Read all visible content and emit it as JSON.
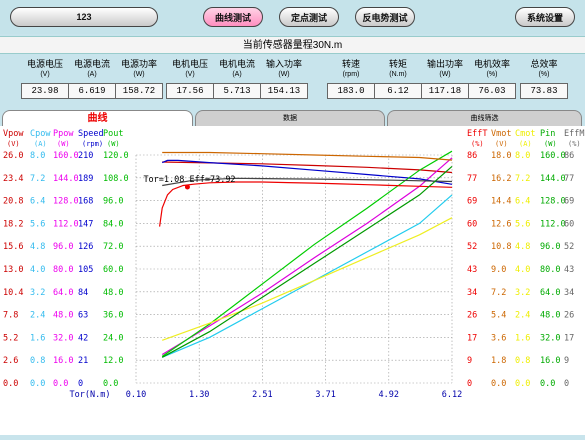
{
  "toolbar": {
    "file_box": "123",
    "curve_test": "曲线测试",
    "point_test": "定点测试",
    "back_emf_test": "反电势测试",
    "settings": "系统设置"
  },
  "subtitle": "当前传感器量程30N.m",
  "metrics": [
    {
      "label": "电源电压",
      "unit": "(V)",
      "value": "23.98"
    },
    {
      "label": "电源电流",
      "unit": "(A)",
      "value": "6.619"
    },
    {
      "label": "电源功率",
      "unit": "(W)",
      "value": "158.72"
    },
    {
      "label": "电机电压",
      "unit": "(V)",
      "value": "17.56"
    },
    {
      "label": "电机电流",
      "unit": "(A)",
      "value": "5.713"
    },
    {
      "label": "输入功率",
      "unit": "(W)",
      "value": "154.13"
    },
    {
      "label": "转速",
      "unit": "(rpm)",
      "value": "183.0"
    },
    {
      "label": "转矩",
      "unit": "(N.m)",
      "value": "6.12"
    },
    {
      "label": "输出功率",
      "unit": "(W)",
      "value": "117.18"
    },
    {
      "label": "电机效率",
      "unit": "(%)",
      "value": "76.03"
    },
    {
      "label": "总效率",
      "unit": "(%)",
      "value": "73.83"
    }
  ],
  "tabs": [
    "曲线",
    "数据",
    "曲线筛选"
  ],
  "chart_data": {
    "type": "line",
    "xlabel": "Tor(N.m)",
    "x_ticks": [
      "0.10",
      "1.30",
      "2.51",
      "3.71",
      "4.92",
      "6.12"
    ],
    "xlim": [
      0.1,
      6.12
    ],
    "annotation": "Tor=1.08 Eff=73.92",
    "left_axes": [
      {
        "name": "Vpow",
        "unit": "(V)",
        "color": "#cc0000",
        "ticks": [
          "26.0",
          "23.4",
          "20.8",
          "18.2",
          "15.6",
          "13.0",
          "10.4",
          "7.8",
          "5.2",
          "2.6",
          "0.0"
        ]
      },
      {
        "name": "Cpow",
        "unit": "(A)",
        "color": "#33bbee",
        "ticks": [
          "8.0",
          "7.2",
          "6.4",
          "5.6",
          "4.8",
          "4.0",
          "3.2",
          "2.4",
          "1.6",
          "0.8",
          "0.0"
        ]
      },
      {
        "name": "Ppow",
        "unit": "(W)",
        "color": "#ee00ee",
        "ticks": [
          "160.0",
          "144.0",
          "128.0",
          "112.0",
          "96.0",
          "80.0",
          "64.0",
          "48.0",
          "32.0",
          "16.0",
          "0.0"
        ]
      },
      {
        "name": "Speed",
        "unit": "(rpm)",
        "color": "#0000cc",
        "ticks": [
          "210",
          "189",
          "168",
          "147",
          "126",
          "105",
          "84",
          "63",
          "42",
          "21",
          "0"
        ]
      },
      {
        "name": "Pout",
        "unit": "(W)",
        "color": "#00bb00",
        "ticks": [
          "120.0",
          "108.0",
          "96.0",
          "84.0",
          "72.0",
          "60.0",
          "48.0",
          "36.0",
          "24.0",
          "12.0",
          "0.0"
        ]
      }
    ],
    "right_axes": [
      {
        "name": "EffT",
        "unit": "(%)",
        "color": "#ee0000",
        "ticks": [
          "86",
          "77",
          "69",
          "60",
          "52",
          "43",
          "34",
          "26",
          "17",
          "9",
          "0"
        ]
      },
      {
        "name": "Vmot",
        "unit": "(V)",
        "color": "#cc6600",
        "ticks": [
          "18.0",
          "16.2",
          "14.4",
          "12.6",
          "10.8",
          "9.0",
          "7.2",
          "5.4",
          "3.6",
          "1.8",
          "0.0"
        ]
      },
      {
        "name": "Cmot",
        "unit": "(A)",
        "color": "#eeee00",
        "ticks": [
          "8.0",
          "7.2",
          "6.4",
          "5.6",
          "4.8",
          "4.0",
          "3.2",
          "2.4",
          "1.6",
          "0.8",
          "0.0"
        ]
      },
      {
        "name": "Pin",
        "unit": "(W)",
        "color": "#00aa00",
        "ticks": [
          "160.0",
          "144.0",
          "128.0",
          "112.0",
          "96.0",
          "80.0",
          "64.0",
          "48.0",
          "32.0",
          "16.0",
          "0.0"
        ]
      },
      {
        "name": "EffM",
        "unit": "(%)",
        "color": "#666666",
        "ticks": [
          "86",
          "77",
          "69",
          "60",
          "52",
          "43",
          "34",
          "26",
          "17",
          "9",
          "0"
        ]
      }
    ],
    "series": [
      {
        "name": "Vpow",
        "color": "#cc0000",
        "x": [
          0.6,
          1.5,
          2.5,
          3.5,
          4.5,
          5.5,
          6.12
        ],
        "y": [
          25.2,
          25.1,
          25.0,
          24.8,
          24.6,
          24.3,
          24.0
        ]
      },
      {
        "name": "Cpow",
        "color": "#22ccee",
        "x": [
          0.6,
          1.5,
          2.5,
          3.5,
          4.5,
          5.5,
          6.12
        ],
        "y": [
          0.9,
          1.6,
          2.6,
          3.6,
          4.6,
          5.6,
          6.6
        ]
      },
      {
        "name": "Ppow",
        "color": "#dd00dd",
        "x": [
          0.6,
          1.5,
          2.5,
          3.5,
          4.5,
          5.5,
          6.12
        ],
        "y": [
          20,
          40,
          63,
          88,
          112,
          138,
          158
        ]
      },
      {
        "name": "Speed",
        "color": "#0000cc",
        "x": [
          0.6,
          0.7,
          0.9,
          1.2,
          1.5,
          2.5,
          3.5,
          4.5,
          5.5,
          6.12
        ],
        "y": [
          203,
          205,
          205,
          204,
          203,
          200,
          196,
          192,
          188,
          183
        ]
      },
      {
        "name": "Pout",
        "color": "#00cc00",
        "x": [
          0.6,
          1.5,
          2.5,
          3.5,
          4.5,
          5.5,
          6.12
        ],
        "y": [
          14,
          31,
          52,
          73,
          92,
          112,
          122
        ]
      },
      {
        "name": "EffT",
        "color": "#ee0000",
        "x": [
          0.55,
          0.6,
          0.7,
          0.8,
          1.0,
          1.2,
          1.5,
          2.0,
          2.5,
          3.0,
          3.5,
          4.0,
          4.5,
          5.0,
          5.5,
          6.12
        ],
        "y": [
          59,
          66,
          71,
          73,
          74.5,
          75,
          75.5,
          75.8,
          75.8,
          75.6,
          75.4,
          75.1,
          74.8,
          74.5,
          74.2,
          73.8
        ]
      },
      {
        "name": "EffM",
        "color": "#444444",
        "x": [
          0.6,
          1.2,
          2.0,
          3.0,
          4.0,
          5.0,
          6.12
        ],
        "y": [
          74.5,
          76.5,
          77.2,
          77.0,
          76.8,
          76.5,
          76.0
        ]
      },
      {
        "name": "Vmot",
        "color": "#cc6600",
        "x": [
          0.6,
          1.5,
          2.5,
          3.5,
          4.5,
          5.5,
          6.12
        ],
        "y": [
          18.2,
          18.2,
          18.1,
          18.0,
          17.9,
          17.8,
          17.6
        ]
      },
      {
        "name": "Cmot",
        "color": "#eeee22",
        "x": [
          0.6,
          1.5,
          2.5,
          3.5,
          4.5,
          5.5,
          6.12
        ],
        "y": [
          1.5,
          2.1,
          2.8,
          3.6,
          4.4,
          5.2,
          5.8
        ]
      },
      {
        "name": "Pin",
        "color": "#009900",
        "x": [
          0.6,
          1.5,
          2.5,
          3.5,
          4.5,
          5.5,
          6.12
        ],
        "y": [
          18,
          36,
          60,
          84,
          108,
          132,
          152
        ]
      }
    ]
  }
}
